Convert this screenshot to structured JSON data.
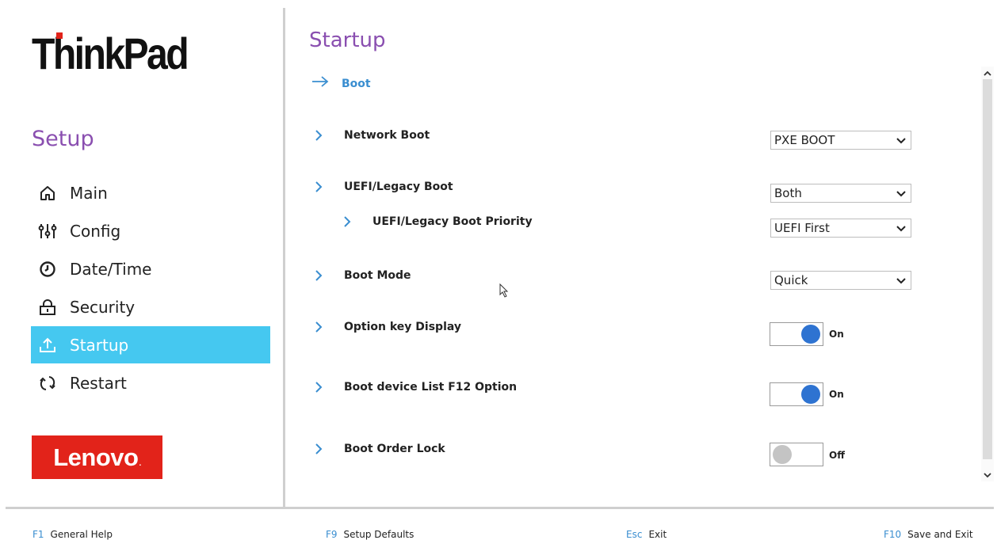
{
  "brand": {
    "product_logo": "ThinkPad",
    "company_logo": "Lenovo"
  },
  "sidebar": {
    "title": "Setup",
    "items": [
      {
        "label": "Main",
        "icon": "home-icon",
        "active": false
      },
      {
        "label": "Config",
        "icon": "sliders-icon",
        "active": false
      },
      {
        "label": "Date/Time",
        "icon": "clock-icon",
        "active": false
      },
      {
        "label": "Security",
        "icon": "lock-icon",
        "active": false
      },
      {
        "label": "Startup",
        "icon": "upload-icon",
        "active": true
      },
      {
        "label": "Restart",
        "icon": "restart-icon",
        "active": false
      }
    ]
  },
  "main": {
    "title": "Startup",
    "breadcrumb": "Boot",
    "rows": {
      "network_boot": {
        "label": "Network Boot",
        "value": "PXE BOOT"
      },
      "uefi_legacy_boot": {
        "label": "UEFI/Legacy Boot",
        "value": "Both"
      },
      "uefi_legacy_priority": {
        "label": "UEFI/Legacy Boot Priority",
        "value": "UEFI First"
      },
      "boot_mode": {
        "label": "Boot Mode",
        "value": "Quick"
      },
      "option_key_display": {
        "label": "Option key Display",
        "value": "On"
      },
      "boot_device_list": {
        "label": "Boot device List F12 Option",
        "value": "On"
      },
      "boot_order_lock": {
        "label": "Boot Order Lock",
        "value": "Off"
      }
    }
  },
  "footer": [
    {
      "key": "F1",
      "label": "General Help"
    },
    {
      "key": "F9",
      "label": "Setup Defaults"
    },
    {
      "key": "Esc",
      "label": "Exit"
    },
    {
      "key": "F10",
      "label": "Save and Exit"
    }
  ],
  "colors": {
    "accent_purple": "#8a4fb0",
    "active_nav": "#45c8f0",
    "link_blue": "#3a8ed0",
    "toggle_on": "#2e73d1",
    "lenovo_red": "#e2231a"
  }
}
